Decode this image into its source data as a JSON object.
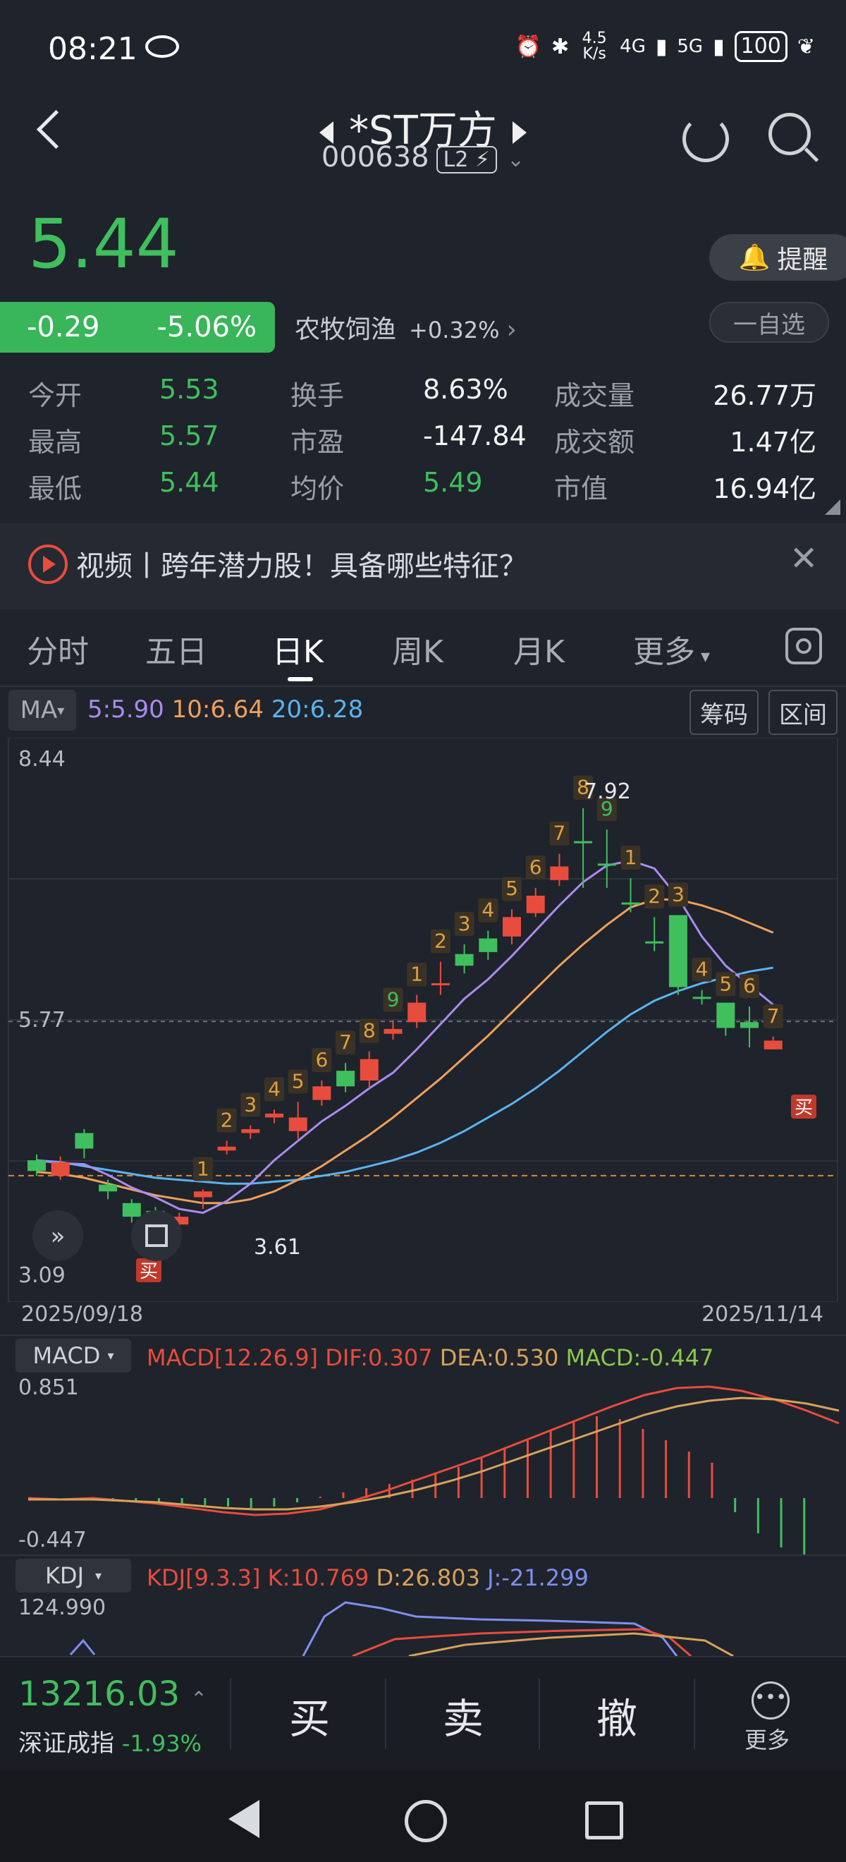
{
  "status_bar": {
    "time": "08:21",
    "net_speed": "4.5 K/s",
    "sig1": "4G",
    "sig2": "5G",
    "battery": "100"
  },
  "header": {
    "name": "*ST万方",
    "code": "000638",
    "level": "L2"
  },
  "quote": {
    "price": "5.44",
    "change": "-0.29",
    "change_pct": "-5.06%",
    "industry": "农牧饲渔",
    "industry_pct": "+0.32%",
    "remind_label": "提醒",
    "watch_label": "一自选"
  },
  "stats": [
    {
      "k": "今开",
      "v": "5.53",
      "c": "green"
    },
    {
      "k": "换手",
      "v": "8.63%",
      "c": "white"
    },
    {
      "k": "成交量",
      "v": "26.77万",
      "c": "white"
    },
    {
      "k": "最高",
      "v": "5.57",
      "c": "green"
    },
    {
      "k": "市盈",
      "v": "-147.84",
      "c": "white"
    },
    {
      "k": "成交额",
      "v": "1.47亿",
      "c": "white"
    },
    {
      "k": "最低",
      "v": "5.44",
      "c": "green"
    },
    {
      "k": "均价",
      "v": "5.49",
      "c": "green"
    },
    {
      "k": "市值",
      "v": "16.94亿",
      "c": "white"
    }
  ],
  "news": {
    "text": "视频丨跨年潜力股！具备哪些特征？"
  },
  "tabs": [
    "分时",
    "五日",
    "日K",
    "周K",
    "月K",
    "更多"
  ],
  "ma": {
    "label": "MA",
    "ma5": "5:5.90",
    "ma10": "10:6.64",
    "ma20": "20:6.28",
    "btn_chips": "筹码",
    "btn_range": "区间"
  },
  "kline": {
    "price_high": "8.44",
    "price_mid": "5.77",
    "price_low": "3.09",
    "label_max": "7.92",
    "label_min": "3.61",
    "date_start": "2025/09/18",
    "date_end": "2025/11/14",
    "buy_label": "买",
    "colors": {
      "up": "#e84c3d",
      "down": "#3fbf5e",
      "ma5": "#a98cf0",
      "ma10": "#f0a05c",
      "ma20": "#5ab4f0"
    }
  },
  "macd": {
    "label": "MACD",
    "params": "MACD[12.26.9]",
    "dif": "DIF:0.307",
    "dea": "DEA:0.530",
    "macd_val": "MACD:-0.447",
    "top": "0.851",
    "bottom": "-0.447"
  },
  "kdj": {
    "label": "KDJ",
    "params": "KDJ[9.3.3]",
    "k": "K:10.769",
    "d": "D:26.803",
    "j": "J:-21.299",
    "top": "124.990"
  },
  "chart_data": {
    "type": "candlestick",
    "ylim": [
      3.09,
      8.44
    ],
    "x_start": "2025/09/18",
    "x_end": "2025/11/14",
    "candles": [
      {
        "o": 4.3,
        "c": 4.19,
        "h": 4.36,
        "l": 4.14,
        "seq": ""
      },
      {
        "o": 4.14,
        "c": 4.28,
        "h": 4.34,
        "l": 4.1,
        "seq": ""
      },
      {
        "o": 4.58,
        "c": 4.42,
        "h": 4.62,
        "l": 4.32,
        "seq": ""
      },
      {
        "o": 4.05,
        "c": 3.98,
        "h": 4.1,
        "l": 3.9,
        "seq": ""
      },
      {
        "o": 3.86,
        "c": 3.72,
        "h": 3.9,
        "l": 3.66,
        "seq": ""
      },
      {
        "o": 3.78,
        "c": 3.64,
        "h": 3.82,
        "l": 3.61,
        "seq": ""
      },
      {
        "o": 3.64,
        "c": 3.72,
        "h": 3.76,
        "l": 3.61,
        "seq": ""
      },
      {
        "o": 3.92,
        "c": 3.98,
        "h": 4.0,
        "l": 3.8,
        "seq": "1"
      },
      {
        "o": 4.4,
        "c": 4.44,
        "h": 4.5,
        "l": 4.36,
        "seq": "2"
      },
      {
        "o": 4.58,
        "c": 4.62,
        "h": 4.66,
        "l": 4.52,
        "seq": "3"
      },
      {
        "o": 4.74,
        "c": 4.78,
        "h": 4.82,
        "l": 4.68,
        "seq": "4"
      },
      {
        "o": 4.6,
        "c": 4.74,
        "h": 4.9,
        "l": 4.52,
        "seq": "5"
      },
      {
        "o": 4.92,
        "c": 5.06,
        "h": 5.12,
        "l": 4.86,
        "seq": "6"
      },
      {
        "o": 5.22,
        "c": 5.06,
        "h": 5.3,
        "l": 5.0,
        "seq": "7"
      },
      {
        "o": 5.12,
        "c": 5.34,
        "h": 5.42,
        "l": 5.04,
        "seq": "8"
      },
      {
        "o": 5.6,
        "c": 5.65,
        "h": 5.74,
        "l": 5.54,
        "seq": "9"
      },
      {
        "o": 5.72,
        "c": 5.92,
        "h": 6.0,
        "l": 5.66,
        "seq": "1"
      },
      {
        "o": 6.1,
        "c": 6.12,
        "h": 6.34,
        "l": 6.0,
        "seq": "2"
      },
      {
        "o": 6.42,
        "c": 6.3,
        "h": 6.52,
        "l": 6.22,
        "seq": "3"
      },
      {
        "o": 6.58,
        "c": 6.44,
        "h": 6.66,
        "l": 6.36,
        "seq": "4"
      },
      {
        "o": 6.6,
        "c": 6.8,
        "h": 6.88,
        "l": 6.52,
        "seq": "5"
      },
      {
        "o": 6.84,
        "c": 7.02,
        "h": 7.1,
        "l": 6.8,
        "seq": "6"
      },
      {
        "o": 7.18,
        "c": 7.32,
        "h": 7.45,
        "l": 7.12,
        "seq": "7"
      },
      {
        "o": 7.58,
        "c": 7.58,
        "h": 7.92,
        "l": 7.1,
        "seq": "8"
      },
      {
        "o": 7.35,
        "c": 7.35,
        "h": 7.7,
        "l": 7.1,
        "seq": "9"
      },
      {
        "o": 6.95,
        "c": 6.95,
        "h": 7.2,
        "l": 6.85,
        "seq": "1"
      },
      {
        "o": 6.55,
        "c": 6.55,
        "h": 6.8,
        "l": 6.45,
        "seq": "2"
      },
      {
        "o": 6.82,
        "c": 6.08,
        "h": 6.82,
        "l": 6.0,
        "seq": "3"
      },
      {
        "o": 5.98,
        "c": 5.98,
        "h": 6.05,
        "l": 5.9,
        "seq": "4"
      },
      {
        "o": 5.92,
        "c": 5.66,
        "h": 5.9,
        "l": 5.58,
        "seq": "5"
      },
      {
        "o": 5.72,
        "c": 5.66,
        "h": 5.88,
        "l": 5.46,
        "seq": "6"
      },
      {
        "o": 5.44,
        "c": 5.53,
        "h": 5.57,
        "l": 5.44,
        "seq": "7"
      }
    ],
    "ma5": [
      4.3,
      4.27,
      4.26,
      4.15,
      4.02,
      3.92,
      3.8,
      3.76,
      3.88,
      4.06,
      4.3,
      4.5,
      4.7,
      4.86,
      5.04,
      5.2,
      5.44,
      5.7,
      5.96,
      6.16,
      6.4,
      6.66,
      6.92,
      7.16,
      7.33,
      7.38,
      7.3,
      7.0,
      6.6,
      6.3,
      6.1,
      5.9
    ],
    "ma10": [
      4.18,
      4.16,
      4.12,
      4.06,
      4.0,
      3.94,
      3.9,
      3.86,
      3.86,
      3.9,
      3.98,
      4.1,
      4.24,
      4.4,
      4.56,
      4.74,
      4.94,
      5.14,
      5.36,
      5.58,
      5.82,
      6.06,
      6.3,
      6.52,
      6.72,
      6.9,
      6.98,
      6.98,
      6.92,
      6.84,
      6.74,
      6.64
    ],
    "ma20": [
      4.3,
      4.28,
      4.24,
      4.2,
      4.16,
      4.12,
      4.1,
      4.08,
      4.06,
      4.06,
      4.08,
      4.1,
      4.14,
      4.18,
      4.24,
      4.3,
      4.38,
      4.48,
      4.6,
      4.74,
      4.88,
      5.04,
      5.22,
      5.42,
      5.62,
      5.8,
      5.94,
      6.04,
      6.12,
      6.18,
      6.24,
      6.28
    ]
  }
}
